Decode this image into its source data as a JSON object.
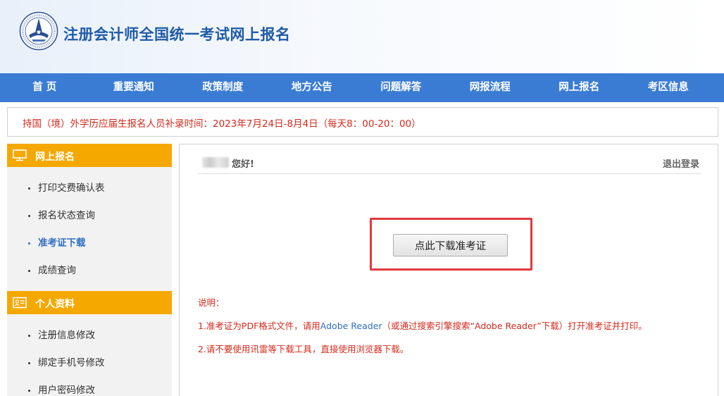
{
  "header": {
    "title": "注册会计师全国统一考试网上报名"
  },
  "nav": {
    "items": [
      "首 页",
      "重要通知",
      "政策制度",
      "地方公告",
      "问题解答",
      "网报流程",
      "网上报名",
      "考区信息"
    ]
  },
  "notice": {
    "text": "持国（境）外学历应届生报名人员补录时间：2023年7月24日-8月4日（每天8：00-20：00）"
  },
  "sidebar": {
    "sections": [
      {
        "title": "网上报名",
        "icon": "monitor-icon",
        "items": [
          "打印交费确认表",
          "报名状态查询",
          "准考证下载",
          "成绩查询"
        ],
        "active_item": "准考证下载"
      },
      {
        "title": "个人资料",
        "icon": "id-card-icon",
        "items": [
          "注册信息修改",
          "绑定手机号修改",
          "用户密码修改"
        ]
      }
    ]
  },
  "main": {
    "greeting": "您好!",
    "logout": "退出登录",
    "download_button": "点此下载准考证",
    "notes": {
      "title": "说明：",
      "line1_before": "1.准考证为PDF格式文件，请用",
      "line1_link": "Adobe Reader",
      "line1_after": "（或通过搜索引擎搜索“Adobe Reader”下载）打开准考证并打印。",
      "line2": "2.请不要使用讯雷等下载工具，直接使用浏览器下载。"
    }
  },
  "colors": {
    "nav_bg": "#3a7cd3",
    "sidebar_header": "#f5a800",
    "notice_text": "#d42a1c",
    "title_blue": "#1f5ba8",
    "highlight_frame": "#e0393e"
  }
}
